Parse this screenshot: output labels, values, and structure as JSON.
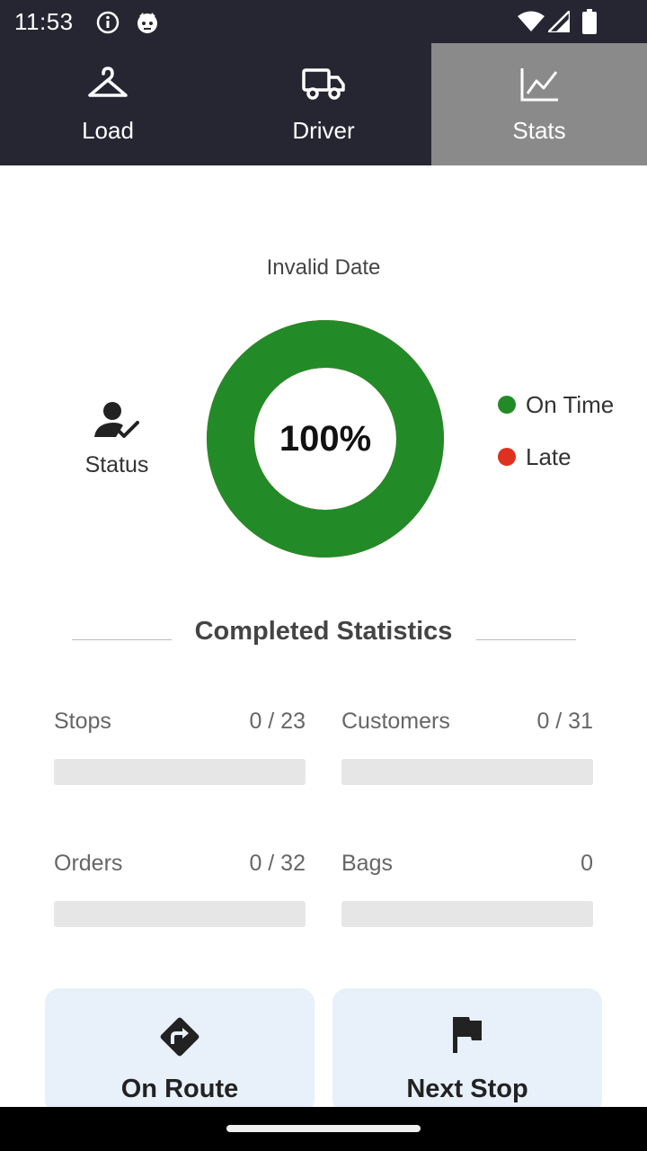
{
  "status_bar": {
    "time": "11:53"
  },
  "tabs": [
    {
      "label": "Load",
      "icon": "hanger-icon",
      "active": false
    },
    {
      "label": "Driver",
      "icon": "truck-icon",
      "active": false
    },
    {
      "label": "Stats",
      "icon": "chart-line-icon",
      "active": true
    }
  ],
  "date_label": "Invalid Date",
  "status_block": {
    "label": "Status",
    "icon": "user-check-icon"
  },
  "on_time_chart": {
    "percent_label": "100%",
    "on_time_fraction": 1.0,
    "late_fraction": 0.0
  },
  "legend": [
    {
      "label": "On Time",
      "color": "#228b28"
    },
    {
      "label": "Late",
      "color": "#e0301e"
    }
  ],
  "section_title": "Completed Statistics",
  "stats": [
    {
      "label": "Stops",
      "value": "0 / 23",
      "progress": 0
    },
    {
      "label": "Customers",
      "value": "0 / 31",
      "progress": 0
    },
    {
      "label": "Orders",
      "value": "0 / 32",
      "progress": 0
    },
    {
      "label": "Bags",
      "value": "0",
      "progress": 0
    }
  ],
  "actions": [
    {
      "label": "On Route",
      "icon": "directions-icon"
    },
    {
      "label": "Next Stop",
      "icon": "flag-icon"
    }
  ],
  "colors": {
    "progress_fill": "#b22222",
    "donut_green": "#228b28",
    "tab_bg": "#262633",
    "active_tab_bg": "#8a8a8a"
  }
}
